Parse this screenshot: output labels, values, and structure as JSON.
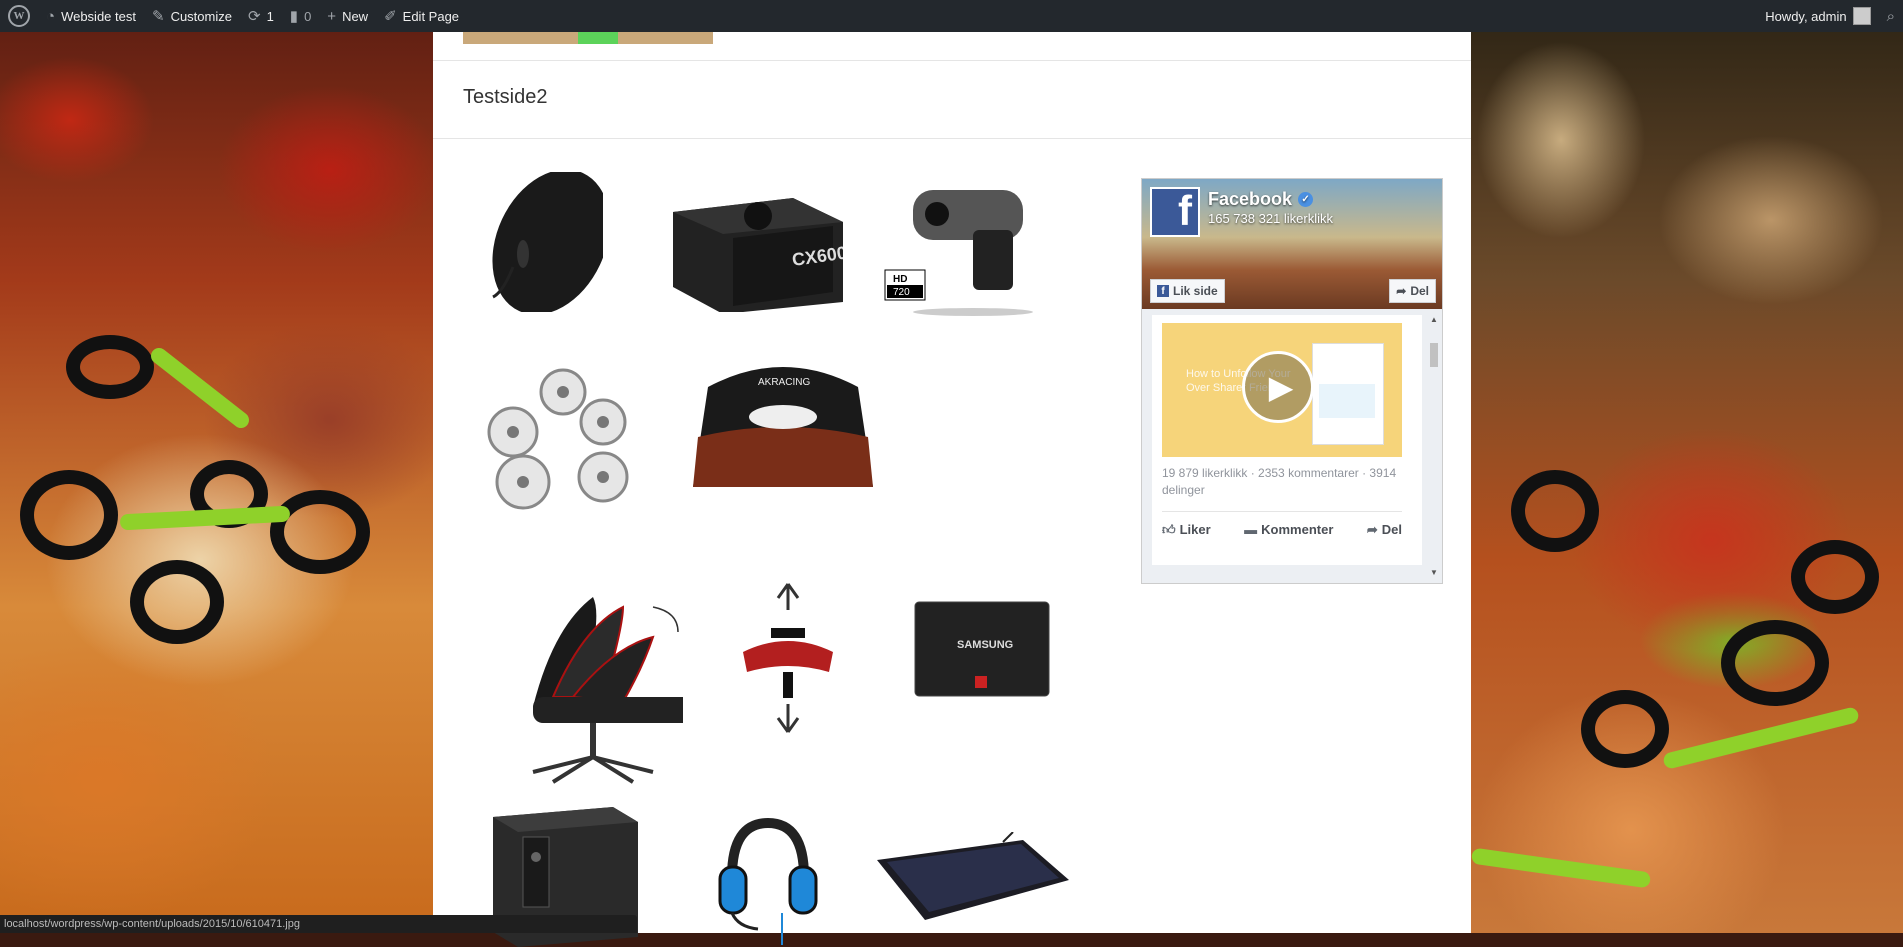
{
  "adminbar": {
    "site_name": "Webside test",
    "customize": "Customize",
    "updates_count": "1",
    "comments_count": "0",
    "new": "New",
    "edit_page": "Edit Page",
    "howdy": "Howdy, admin"
  },
  "page": {
    "title": "Testside2"
  },
  "products": [
    {
      "name": "mouse"
    },
    {
      "name": "power-supply",
      "label": "CX600"
    },
    {
      "name": "webcam",
      "badge_top": "HD",
      "badge_bottom": "720"
    },
    {
      "name": "chair-wheels"
    },
    {
      "name": "chair-back",
      "label": "AKRACING"
    },
    {
      "name": "reclining-chair"
    },
    {
      "name": "chair-height"
    },
    {
      "name": "ssd",
      "label": "SAMSUNG"
    },
    {
      "name": "ups"
    },
    {
      "name": "headset"
    },
    {
      "name": "keyboard"
    }
  ],
  "facebook": {
    "page_name": "Facebook",
    "likes": "165 738 321 likerklikk",
    "like_button": "Lik side",
    "share_button": "Del",
    "video_text": "How to Unfollow Your Over Sharer Friend",
    "stats": "19 879 likerklikk · 2353 kommentarer · 3914 delinger",
    "action_like": "Liker",
    "action_comment": "Kommenter",
    "action_share": "Del"
  },
  "statusbar": {
    "url": "localhost/wordpress/wp-content/uploads/2015/10/610471.jpg"
  },
  "colors": {
    "adminbar_bg": "#23282d",
    "facebook_blue": "#3b5998"
  }
}
